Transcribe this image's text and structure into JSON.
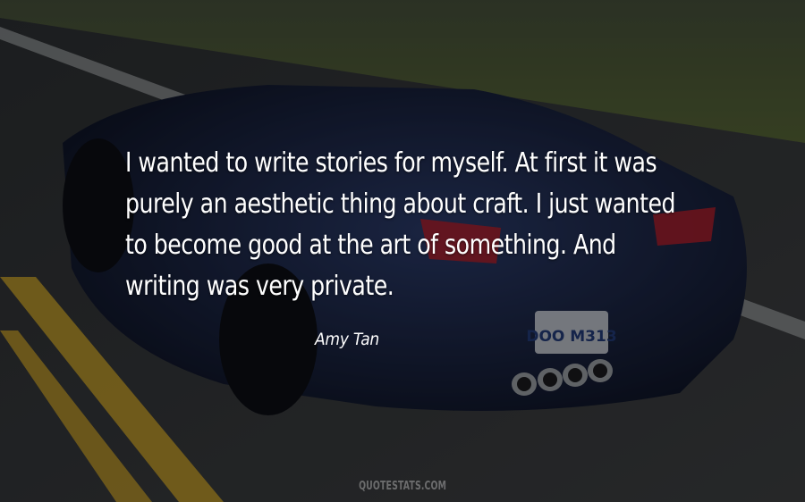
{
  "quote": {
    "lines": [
      "I wanted to write stories for myself. At first it was",
      "purely an aesthetic thing about craft. I just wanted",
      "to become good at the art of something. And",
      "writing was very private."
    ],
    "author": "Amy Tan"
  },
  "watermark": "QUOTESTATS.COM",
  "background": {
    "subject": "blue convertible sports car driving on a road",
    "plate": "DOO M313",
    "colors": {
      "car": "#1d2a4f",
      "road": "#3a3c3e",
      "grass": "#5c6a34",
      "line": "#c9a12a",
      "taillight": "#b3202c"
    }
  }
}
